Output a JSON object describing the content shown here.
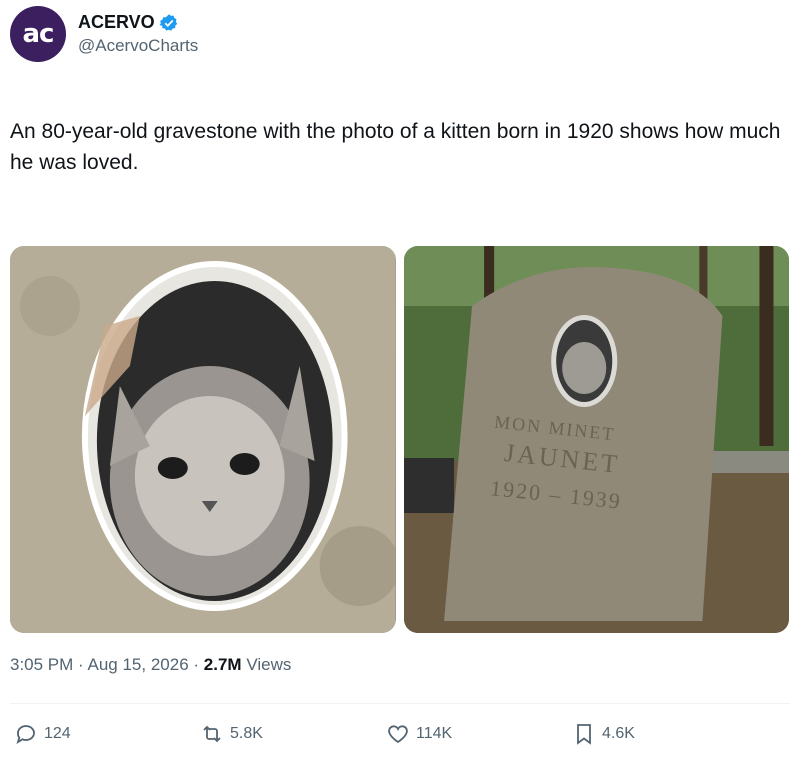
{
  "author": {
    "avatar_text": "ac",
    "display_name": "ACERVO",
    "handle": "@AcervoCharts",
    "verified": true
  },
  "tweet": {
    "text": "An 80-year-old gravestone with the photo of a kitten born in 1920 shows how much he was loved."
  },
  "media": {
    "photo1": "close-up of oval kitten portrait on weathered stone",
    "photo2": "gravestone in wooded cemetery",
    "inscription_line1": "MON MINET",
    "inscription_line2": "JAUNET",
    "inscription_line3": "1920 – 1939"
  },
  "meta": {
    "time": "3:05 PM",
    "date": "Aug 15, 2026",
    "views_count": "2.7M",
    "views_label": "Views"
  },
  "actions": {
    "replies": "124",
    "reposts": "5.8K",
    "likes": "114K",
    "bookmarks": "4.6K"
  },
  "colors": {
    "avatar_bg": "#3b1f5e",
    "verified_blue": "#1d9bf0",
    "muted_text": "#536471"
  }
}
